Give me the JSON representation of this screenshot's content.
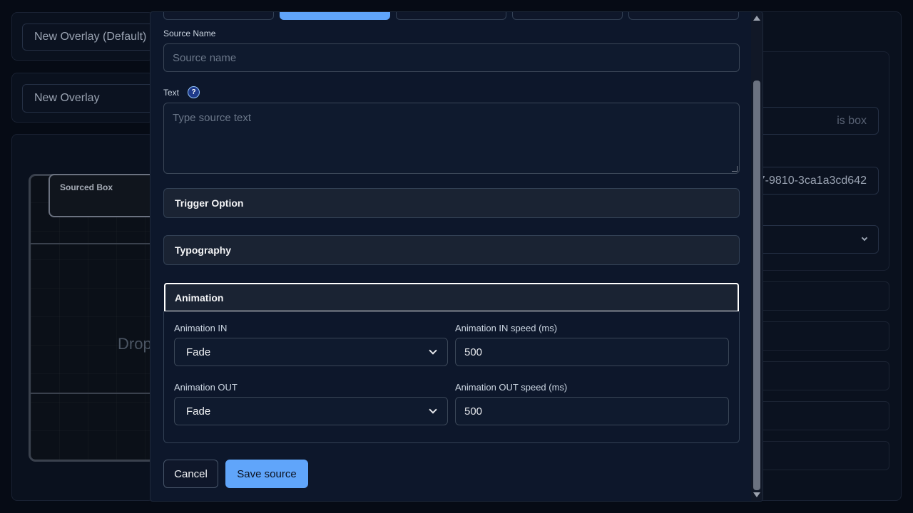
{
  "background": {
    "overlay_default_label": "New Overlay (Default)",
    "overlay_label": "New Overlay",
    "sourced_box_label": "Sourced Box",
    "drop_text": "Drop",
    "right_field_placeholder": "is box",
    "right_field_id": "7-9810-3ca1a3cd642"
  },
  "modal": {
    "source_name": {
      "label": "Source Name",
      "placeholder": "Source name"
    },
    "text": {
      "label": "Text",
      "help": "?",
      "placeholder": "Type source text"
    },
    "sections": {
      "trigger": "Trigger Option",
      "typography": "Typography",
      "animation": "Animation"
    },
    "animation": {
      "in_label": "Animation IN",
      "in_value": "Fade",
      "in_speed_label": "Animation IN speed (ms)",
      "in_speed_value": "500",
      "out_label": "Animation OUT",
      "out_value": "Fade",
      "out_speed_label": "Animation OUT speed (ms)",
      "out_speed_value": "500"
    },
    "buttons": {
      "cancel": "Cancel",
      "save": "Save source"
    }
  },
  "colors": {
    "accent": "#60a5fa",
    "modal_bg": "#0d172b",
    "page_bg": "#060b15"
  }
}
